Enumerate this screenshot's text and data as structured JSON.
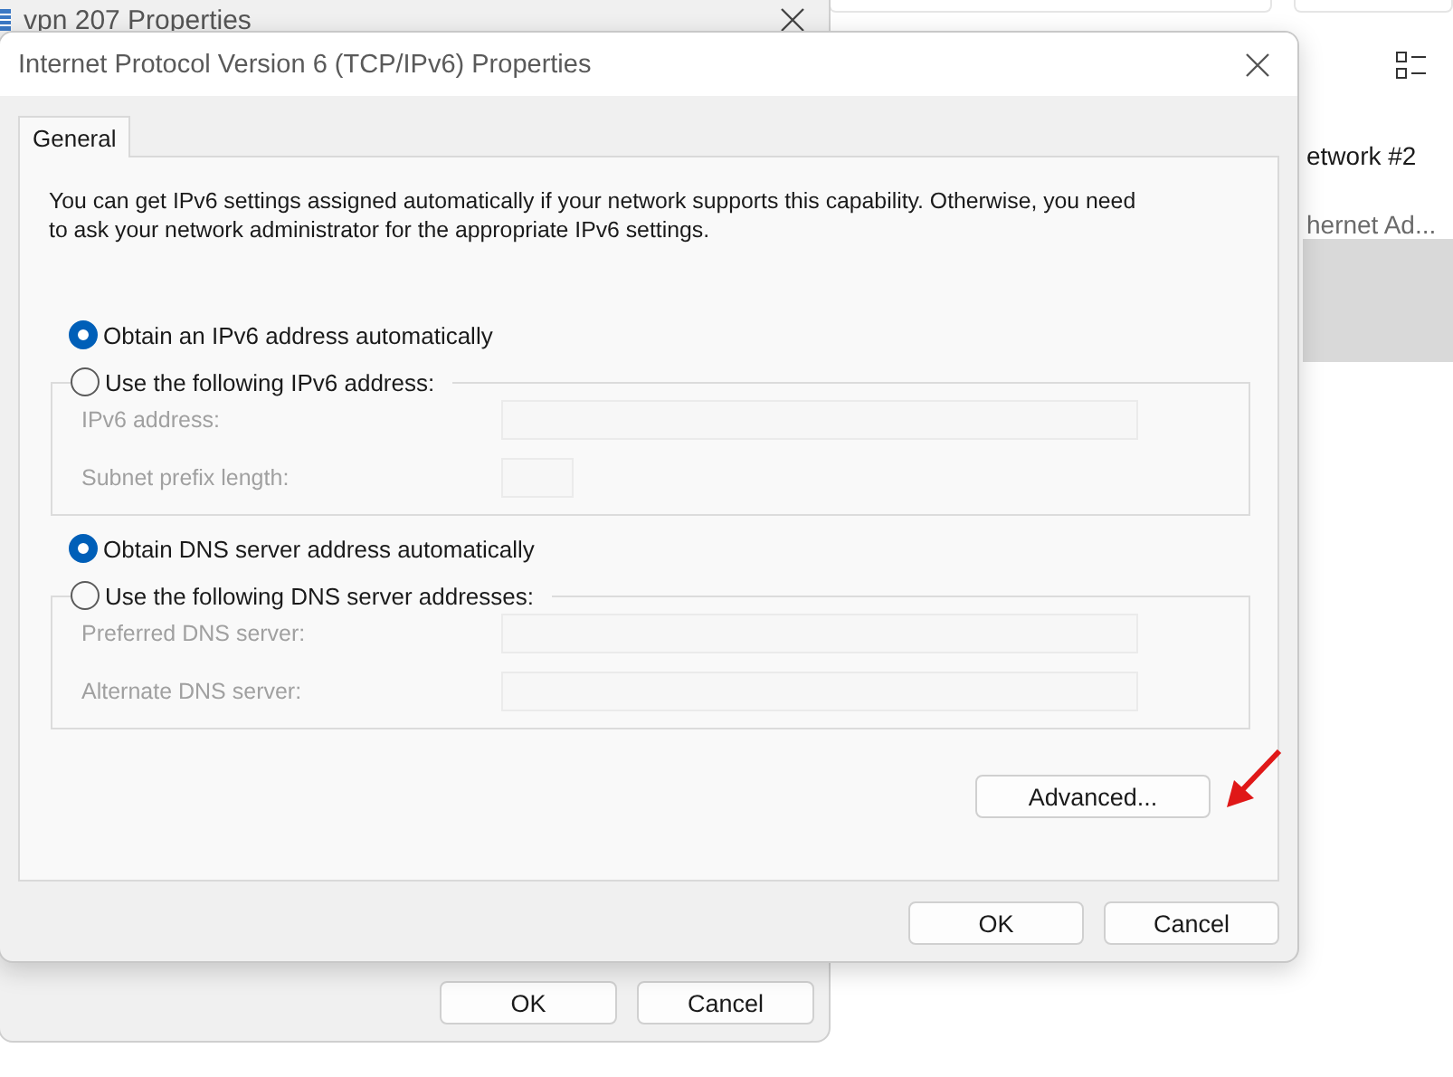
{
  "back_window": {
    "title": "vpn 207 Properties",
    "buttons": [
      {
        "label": "OK"
      },
      {
        "label": "Cancel"
      }
    ]
  },
  "explorer": {
    "items": [
      {
        "title": "etwork #2",
        "subtitle": "hernet Ad...",
        "selected": false
      },
      {
        "selected": true
      }
    ]
  },
  "dialog": {
    "title": "Internet Protocol Version 6 (TCP/IPv6) Properties",
    "tabs": [
      {
        "label": "General",
        "selected": true
      }
    ],
    "description": "You can get IPv6 settings assigned automatically if your network supports this capability. Otherwise, you need to ask your network administrator for the appropriate IPv6 settings.",
    "sections": [
      {
        "auto_option": {
          "label": "Obtain an IPv6 address automatically",
          "selected": true
        },
        "manual_option": {
          "label": "Use the following IPv6 address:",
          "selected": false
        },
        "fields": [
          {
            "label": "IPv6 address:",
            "disabled": true,
            "kind": "wide"
          },
          {
            "label": "Subnet prefix length:",
            "disabled": true,
            "kind": "short"
          }
        ]
      },
      {
        "auto_option": {
          "label": "Obtain DNS server address automatically",
          "selected": true
        },
        "manual_option": {
          "label": "Use the following DNS server addresses:",
          "selected": false
        },
        "fields": [
          {
            "label": "Preferred DNS server:",
            "disabled": true,
            "kind": "wide"
          },
          {
            "label": "Alternate DNS server:",
            "disabled": true,
            "kind": "wide"
          }
        ]
      }
    ],
    "advanced_button": "Advanced...",
    "buttons": [
      {
        "label": "OK"
      },
      {
        "label": "Cancel"
      }
    ]
  }
}
